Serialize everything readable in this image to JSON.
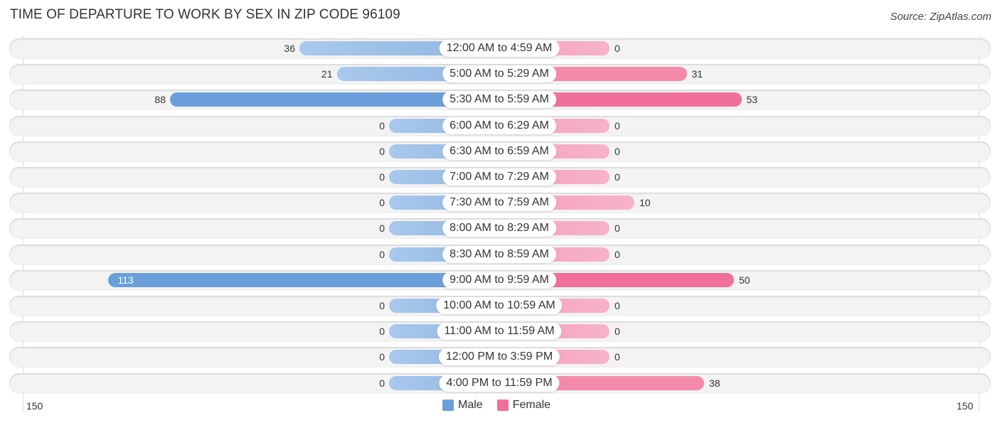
{
  "title": "TIME OF DEPARTURE TO WORK BY SEX IN ZIP CODE 96109",
  "source": "Source: ZipAtlas.com",
  "chart_data": {
    "type": "bar",
    "orientation": "horizontal-diverging",
    "title": "TIME OF DEPARTURE TO WORK BY SEX IN ZIP CODE 96109",
    "categories": [
      "12:00 AM to 4:59 AM",
      "5:00 AM to 5:29 AM",
      "5:30 AM to 5:59 AM",
      "6:00 AM to 6:29 AM",
      "6:30 AM to 6:59 AM",
      "7:00 AM to 7:29 AM",
      "7:30 AM to 7:59 AM",
      "8:00 AM to 8:29 AM",
      "8:30 AM to 8:59 AM",
      "9:00 AM to 9:59 AM",
      "10:00 AM to 10:59 AM",
      "11:00 AM to 11:59 AM",
      "12:00 PM to 3:59 PM",
      "4:00 PM to 11:59 PM"
    ],
    "series": [
      {
        "name": "Male",
        "color": "#6a9fdb",
        "values": [
          36,
          21,
          88,
          0,
          0,
          0,
          0,
          0,
          0,
          113,
          0,
          0,
          0,
          0
        ]
      },
      {
        "name": "Female",
        "color": "#f07099",
        "values": [
          0,
          31,
          53,
          0,
          0,
          0,
          10,
          0,
          0,
          50,
          0,
          0,
          0,
          38
        ]
      }
    ],
    "axis": {
      "left_label": "150",
      "right_label": "150",
      "range": [
        0,
        150
      ]
    },
    "legend": {
      "position": "bottom-center",
      "items": [
        "Male",
        "Female"
      ]
    }
  }
}
